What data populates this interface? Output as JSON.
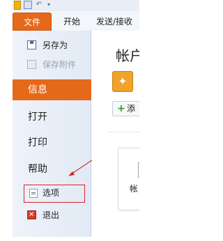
{
  "ribbon": {
    "tabs": [
      {
        "label": "文件"
      },
      {
        "label": "开始"
      },
      {
        "label": "发送/接收"
      }
    ]
  },
  "sidebar": {
    "items": [
      {
        "label": "另存为"
      },
      {
        "label": "保存附件"
      },
      {
        "label": "信息"
      },
      {
        "label": "打开"
      },
      {
        "label": "打印"
      },
      {
        "label": "帮助"
      },
      {
        "label": "选项"
      },
      {
        "label": "退出"
      }
    ]
  },
  "content": {
    "title": "帐户",
    "add_button": "添",
    "card_label": "帐"
  },
  "colors": {
    "accent": "#e5691a",
    "highlight_border": "#d9232a"
  }
}
